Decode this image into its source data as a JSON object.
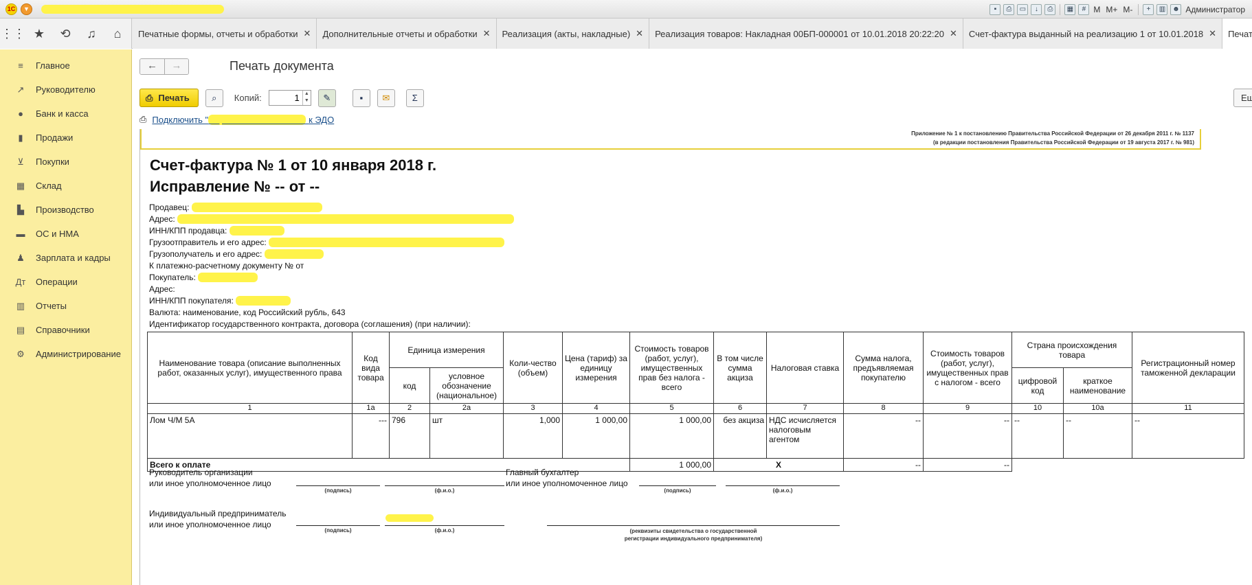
{
  "window": {
    "title": "",
    "user": "Администратор",
    "toolbar_m": "M",
    "toolbar_mplus": "M+",
    "toolbar_mminus": "M-"
  },
  "tabs": [
    {
      "label": "Печатные формы, отчеты и обработки"
    },
    {
      "label": "Дополнительные отчеты и обработки"
    },
    {
      "label": "Реализация (акты, накладные)"
    },
    {
      "label": "Реализация товаров: Накладная 00БП-000001 от 10.01.2018 20:22:20"
    },
    {
      "label": "Счет-фактура выданный на реализацию 1 от 10.01.2018"
    },
    {
      "label": "Печать документ"
    }
  ],
  "sidebar": {
    "items": [
      {
        "label": "Главное",
        "icon": "menu-icon"
      },
      {
        "label": "Руководителю",
        "icon": "trend-icon"
      },
      {
        "label": "Банк и касса",
        "icon": "ruble-icon"
      },
      {
        "label": "Продажи",
        "icon": "bag-icon"
      },
      {
        "label": "Покупки",
        "icon": "cart-icon"
      },
      {
        "label": "Склад",
        "icon": "warehouse-icon"
      },
      {
        "label": "Производство",
        "icon": "factory-icon"
      },
      {
        "label": "ОС и НМА",
        "icon": "truck-icon"
      },
      {
        "label": "Зарплата и кадры",
        "icon": "person-icon"
      },
      {
        "label": "Операции",
        "icon": "operations-icon"
      },
      {
        "label": "Отчеты",
        "icon": "bar-chart-icon"
      },
      {
        "label": "Справочники",
        "icon": "book-icon"
      },
      {
        "label": "Администрирование",
        "icon": "gear-icon"
      }
    ]
  },
  "page": {
    "title": "Печать документа",
    "print_label": "Печать",
    "copies_label": "Копий:",
    "copies_value": "1",
    "edo_prefix": "Подключить \"",
    "edo_suffix": "к ЭДО",
    "right_button": "Ещ"
  },
  "document": {
    "annex_line1": "Приложение № 1 к постановлению Правительства Российской Федерации от 26 декабря 2011 г. № 1137",
    "annex_line2": "(в редакции постановления Правительства Российской Федерации от 19 августа 2017 г. № 981)",
    "heading": "Счет-фактура № 1 от 10 января 2018 г.",
    "correction": "Исправление № -- от --",
    "seller": "Продавец: ",
    "address": "Адрес: ",
    "seller_inn": "ИНН/КПП продавца: ",
    "shipper": "Грузоотправитель и его адрес: ",
    "consignee": "Грузополучатель и его адрес: ",
    "payment_doc": "К платежно-расчетному документу №     от",
    "buyer": "Покупатель: ",
    "buyer_address": "Адрес:",
    "buyer_inn": "ИНН/КПП покупателя: ",
    "currency": "Валюта: наименование, код Российский рубль, 643",
    "contract_id": "Идентификатор государственного контракта, договора (соглашения) (при наличии):"
  },
  "table": {
    "headers": {
      "name": "Наименование товара (описание выполненных работ, оказанных услуг), имущественного права",
      "kind_code": "Код вида товара",
      "unit": "Единица измерения",
      "unit_code": "код",
      "unit_name": "условное обозначение (национальное)",
      "qty": "Коли-чество (объем)",
      "price": "Цена (тариф) за единицу измерения",
      "cost_no_tax": "Стоимость товаров (работ, услуг), имущественных прав без налога - всего",
      "excise": "В том числе сумма акциза",
      "tax_rate": "Налоговая ставка",
      "tax_sum": "Сумма налога, предъявляемая покупателю",
      "cost_with_tax": "Стоимость товаров (работ, услуг), имущественных прав с налогом - всего",
      "country": "Страна происхождения товара",
      "country_code": "цифровой код",
      "country_name": "краткое наименование",
      "customs": "Регистрационный номер таможенной декларации"
    },
    "numbers": [
      "1",
      "1а",
      "2",
      "2а",
      "3",
      "4",
      "5",
      "6",
      "7",
      "8",
      "9",
      "10",
      "10а",
      "11"
    ],
    "row": {
      "name": "Лом Ч/М 5А",
      "kind_code": "---",
      "unit_code": "796",
      "unit_name": "шт",
      "qty": "1,000",
      "price": "1 000,00",
      "cost_no_tax": "1 000,00",
      "excise": "без акциза",
      "tax_rate": "НДС исчисляется налоговым агентом",
      "tax_sum": "--",
      "cost_with_tax": "--",
      "country_code": "--",
      "country_name": "--",
      "customs": "--"
    },
    "total": {
      "label": "Всего к оплате",
      "cost_no_tax": "1 000,00",
      "excise": "X",
      "tax_sum": "--",
      "cost_with_tax": "--"
    }
  },
  "signatures": {
    "head_line1": "Руководитель организации",
    "head_line2": "или иное уполномоченное лицо",
    "accountant_line1": "Главный бухгалтер",
    "accountant_line2": "или иное уполномоченное лицо",
    "entrepreneur_line1": "Индивидуальный предприниматель",
    "entrepreneur_line2": "или иное уполномоченное лицо",
    "cap_signature": "(подпись)",
    "cap_name": "(ф.и.о.)",
    "cap_registration_line1": "(реквизиты свидетельства о государственной",
    "cap_registration_line2": "регистрации индивидуального предпринимателя)"
  },
  "colors": {
    "sidebar_bg": "#fbeea0",
    "print_button": "#f0cc00",
    "redaction_highlight": "#fff34a",
    "link": "#1a4f8a"
  }
}
